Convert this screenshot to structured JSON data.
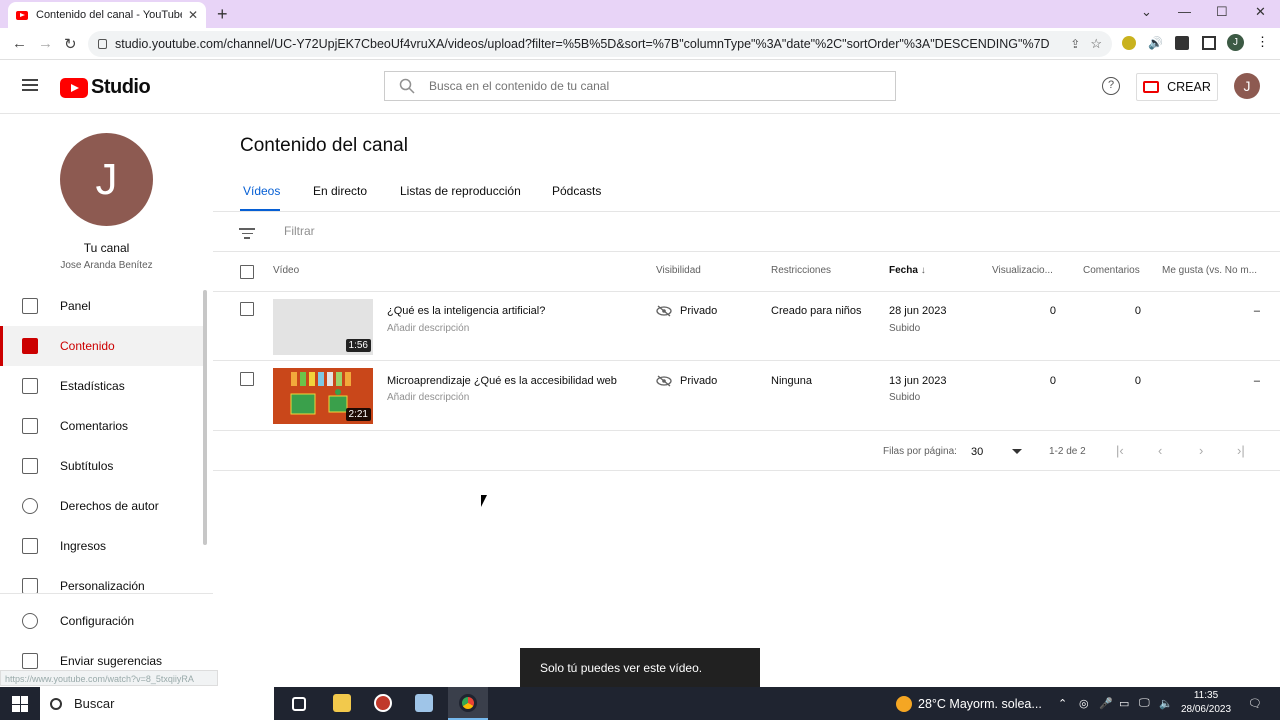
{
  "browser": {
    "tab_title": "Contenido del canal - YouTube S",
    "url": "studio.youtube.com/channel/UC-Y72UpjEK7CbeoUf4vruXA/videos/upload?filter=%5B%5D&sort=%7B\"columnType\"%3A\"date\"%2C\"sortOrder\"%3A\"DESCENDING\"%7D",
    "profile_initial": "J"
  },
  "header": {
    "logo_text": "Studio",
    "search_placeholder": "Busca en el contenido de tu canal",
    "help_icon": "?",
    "create_label": "CREAR",
    "avatar_initial": "J"
  },
  "sidebar": {
    "avatar_initial": "J",
    "channel_title": "Tu canal",
    "channel_name": "Jose Aranda Benítez",
    "items": [
      {
        "label": "Panel",
        "icon": "dashboard-icon"
      },
      {
        "label": "Contenido",
        "icon": "content-icon",
        "active": true
      },
      {
        "label": "Estadísticas",
        "icon": "analytics-icon"
      },
      {
        "label": "Comentarios",
        "icon": "comments-icon"
      },
      {
        "label": "Subtítulos",
        "icon": "subtitles-icon"
      },
      {
        "label": "Derechos de autor",
        "icon": "copyright-icon"
      },
      {
        "label": "Ingresos",
        "icon": "earn-icon"
      },
      {
        "label": "Personalización",
        "icon": "customization-icon"
      }
    ],
    "bottom_items": [
      {
        "label": "Configuración",
        "icon": "settings-icon"
      },
      {
        "label": "Enviar sugerencias",
        "icon": "feedback-icon"
      }
    ]
  },
  "main": {
    "title": "Contenido del canal",
    "tabs": [
      "Vídeos",
      "En directo",
      "Listas de reproducción",
      "Pódcasts"
    ],
    "filter_placeholder": "Filtrar",
    "columns": {
      "video": "Vídeo",
      "visibility": "Visibilidad",
      "restrictions": "Restricciones",
      "date": "Fecha",
      "views": "Visualizacio...",
      "comments": "Comentarios",
      "likes": "Me gusta (vs. No m..."
    },
    "rows": [
      {
        "title": "¿Qué es la inteligencia artificial?",
        "description": "Añadir descripción",
        "duration": "1:56",
        "visibility": "Privado",
        "restriction": "Creado para niños",
        "date": "28 jun 2023",
        "status": "Subido",
        "views": "0",
        "comments": "0",
        "likes": "–"
      },
      {
        "title": "Microaprendizaje ¿Qué es la accesibilidad web",
        "description": "Añadir descripción",
        "duration": "2:21",
        "visibility": "Privado",
        "restriction": "Ninguna",
        "date": "13 jun 2023",
        "status": "Subido",
        "views": "0",
        "comments": "0",
        "likes": "–"
      }
    ],
    "pager": {
      "rows_per_page_label": "Filas por página:",
      "rows_per_page": "30",
      "range": "1-2 de 2"
    }
  },
  "toast": "Solo tú puedes ver este vídeo.",
  "status_url": "https://www.youtube.com/watch?v=8_5txqiiyRA",
  "taskbar": {
    "search_label": "Buscar",
    "weather": "28°C  Mayorm. solea...",
    "time": "11:35",
    "date": "28/06/2023"
  },
  "colors": {
    "accent_red": "#ff0000",
    "active_blue": "#065fd4",
    "avatar_brown": "#8d5a51"
  }
}
